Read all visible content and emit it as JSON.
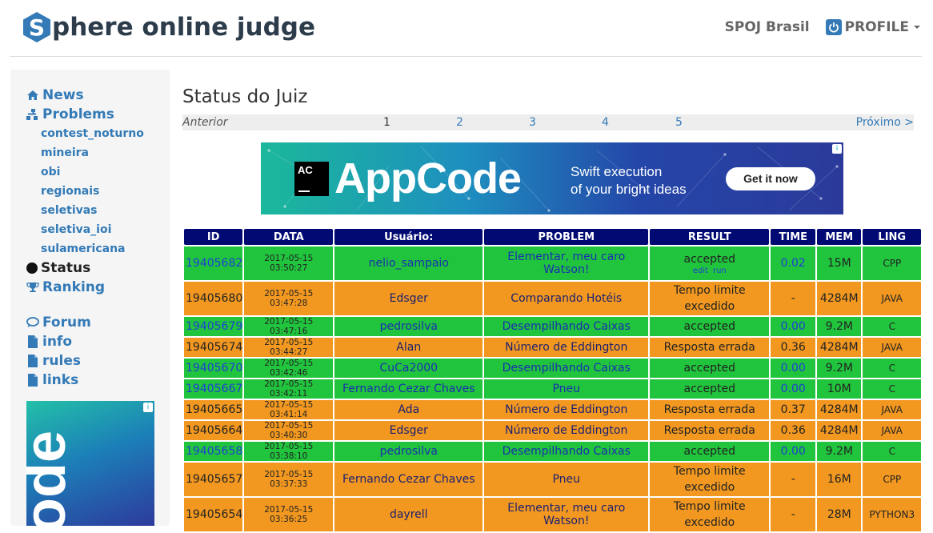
{
  "header": {
    "logo_letter": "S",
    "logo_text": "phere online judge",
    "region_link": "SPOJ Brasil",
    "profile_label": "PROFILE"
  },
  "sidebar": {
    "news": "News",
    "problems": "Problems",
    "sub_items": [
      "contest_noturno",
      "mineira",
      "obi",
      "regionais",
      "seletivas",
      "seletiva_ioi",
      "sulamericana"
    ],
    "status": "Status",
    "ranking": "Ranking",
    "forum": "Forum",
    "info": "info",
    "rules": "rules",
    "links": "links",
    "ad_text": "ode"
  },
  "main": {
    "title": "Status do Juiz",
    "pager": {
      "prev": "Anterior",
      "pages": [
        "1",
        "2",
        "3",
        "4",
        "5"
      ],
      "next": "Próximo >"
    },
    "banner": {
      "logo_abbr": "AC",
      "product": "AppCode",
      "tagline_1": "Swift execution",
      "tagline_2": "of your bright ideas",
      "cta": "Get it now"
    },
    "table": {
      "headers": [
        "ID",
        "DATA",
        "Usuário:",
        "PROBLEM",
        "RESULT",
        "TIME",
        "MEM",
        "LING"
      ],
      "rows": [
        {
          "id": "19405682",
          "date": "2017-05-15 03:50:27",
          "user": "nelio_sampaio",
          "problem": "Elementar, meu caro Watson!",
          "result": "accepted",
          "edit": "edit",
          "run": "run",
          "time": "0.02",
          "mem": "15M",
          "lang": "CPP",
          "status": "ok"
        },
        {
          "id": "19405680",
          "date": "2017-05-15 03:47:28",
          "user": "Edsger",
          "problem": "Comparando Hotéis",
          "result": "Tempo limite excedido",
          "time": "-",
          "mem": "4284M",
          "lang": "JAVA",
          "status": "bad"
        },
        {
          "id": "19405679",
          "date": "2017-05-15 03:47:16",
          "user": "pedrosilva",
          "problem": "Desempilhando Caixas",
          "result": "accepted",
          "time": "0.00",
          "mem": "9.2M",
          "lang": "C",
          "status": "ok"
        },
        {
          "id": "19405674",
          "date": "2017-05-15 03:44:27",
          "user": "Alan",
          "problem": "Número de Eddington",
          "result": "Resposta errada",
          "time": "0.36",
          "mem": "4284M",
          "lang": "JAVA",
          "status": "bad"
        },
        {
          "id": "19405670",
          "date": "2017-05-15 03:42:46",
          "user": "CuCa2000",
          "problem": "Desempilhando Caixas",
          "result": "accepted",
          "time": "0.00",
          "mem": "9.2M",
          "lang": "C",
          "status": "ok"
        },
        {
          "id": "19405667",
          "date": "2017-05-15 03:42:11",
          "user": "Fernando Cezar Chaves",
          "problem": "Pneu",
          "result": "accepted",
          "time": "0.00",
          "mem": "10M",
          "lang": "C",
          "status": "ok"
        },
        {
          "id": "19405665",
          "date": "2017-05-15 03:41:14",
          "user": "Ada",
          "problem": "Número de Eddington",
          "result": "Resposta errada",
          "time": "0.37",
          "mem": "4284M",
          "lang": "JAVA",
          "status": "bad"
        },
        {
          "id": "19405664",
          "date": "2017-05-15 03:40:30",
          "user": "Edsger",
          "problem": "Número de Eddington",
          "result": "Resposta errada",
          "time": "0.36",
          "mem": "4284M",
          "lang": "JAVA",
          "status": "bad"
        },
        {
          "id": "19405658",
          "date": "2017-05-15 03:38:10",
          "user": "pedrosilva",
          "problem": "Desempilhando Caixas",
          "result": "accepted",
          "time": "0.00",
          "mem": "9.2M",
          "lang": "C",
          "status": "ok"
        },
        {
          "id": "19405657",
          "date": "2017-05-15 03:37:33",
          "user": "Fernando Cezar Chaves",
          "problem": "Pneu",
          "result": "Tempo limite excedido",
          "time": "-",
          "mem": "16M",
          "lang": "CPP",
          "status": "bad"
        },
        {
          "id": "19405654",
          "date": "2017-05-15 03:36:25",
          "user": "dayrell",
          "problem": "Elementar, meu caro Watson!",
          "result": "Tempo limite excedido",
          "time": "-",
          "mem": "28M",
          "lang": "PYTHON3",
          "status": "bad"
        }
      ]
    }
  }
}
